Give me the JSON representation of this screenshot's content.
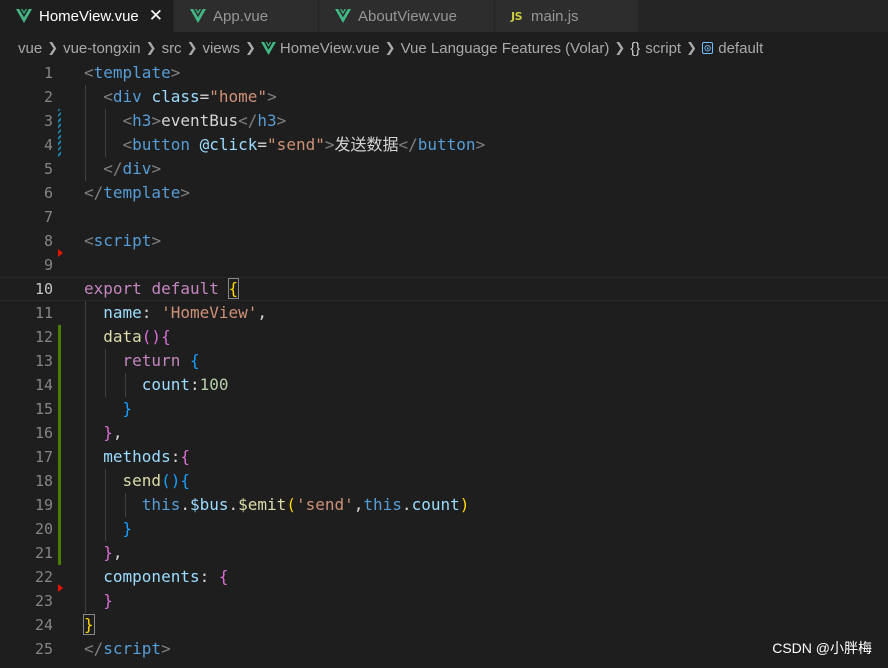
{
  "tabs": [
    {
      "label": "HomeView.vue",
      "icon": "vue-icon",
      "active": true,
      "close": "✕"
    },
    {
      "label": "App.vue",
      "icon": "vue-icon",
      "active": false
    },
    {
      "label": "AboutView.vue",
      "icon": "vue-icon",
      "active": false
    },
    {
      "label": "main.js",
      "icon": "js-icon",
      "icon_text": "JS",
      "active": false
    }
  ],
  "breadcrumb": {
    "parts": [
      "vue",
      "vue-tongxin",
      "src",
      "views",
      "HomeView.vue",
      "Vue Language Features (Volar)",
      "script",
      "default"
    ],
    "braces_glyph": "{}"
  },
  "editor": {
    "current_line": 10,
    "line_numbers": [
      "1",
      "2",
      "3",
      "4",
      "5",
      "6",
      "7",
      "8",
      "9",
      "10",
      "11",
      "12",
      "13",
      "14",
      "15",
      "16",
      "17",
      "18",
      "19",
      "20",
      "21",
      "22",
      "23",
      "24",
      "25"
    ],
    "code": {
      "l1": {
        "open": "<",
        "tag": "template",
        "close": ">"
      },
      "l2": {
        "open": "<",
        "tag": "div",
        "attr": "class",
        "eq": "=",
        "val": "\"home\"",
        "close": ">"
      },
      "l3": {
        "open": "<",
        "tag": "h3",
        "close": ">",
        "text": "eventBus",
        "open2": "</",
        "tag2": "h3",
        "close2": ">"
      },
      "l4": {
        "open": "<",
        "tag": "button",
        "attr": "@click",
        "eq": "=",
        "val": "\"send\"",
        "close": ">",
        "text": "发送数据",
        "open2": "</",
        "tag2": "button",
        "close2": ">"
      },
      "l5": {
        "open": "</",
        "tag": "div",
        "close": ">"
      },
      "l6": {
        "open": "</",
        "tag": "template",
        "close": ">"
      },
      "l8": {
        "open": "<",
        "tag": "script",
        "close": ">"
      },
      "l10": {
        "kw1": "export",
        "kw2": "default",
        "brace": "{"
      },
      "l11": {
        "prop": "name",
        "colon": ": ",
        "str": "'HomeView'",
        "comma": ","
      },
      "l12": {
        "fn": "data",
        "paren": "()",
        "brace": "{"
      },
      "l13": {
        "kw": "return",
        "brace": "{"
      },
      "l14": {
        "prop": "count",
        "colon": ":",
        "num": "100"
      },
      "l15": {
        "brace": "}"
      },
      "l16": {
        "brace": "}",
        "comma": ","
      },
      "l17": {
        "prop": "methods",
        "colon": ":",
        "brace": "{"
      },
      "l18": {
        "fn": "send",
        "paren": "()",
        "brace": "{"
      },
      "l19": {
        "this1": "this",
        "dot1": ".",
        "p1": "$bus",
        "dot2": ".",
        "fn": "$emit",
        "po": "(",
        "str": "'send'",
        "comma": ",",
        "this2": "this",
        "dot3": ".",
        "p2": "count",
        "pc": ")"
      },
      "l20": {
        "brace": "}"
      },
      "l21": {
        "brace": "}",
        "comma": ","
      },
      "l22": {
        "prop": "components",
        "colon": ": ",
        "brace": "{"
      },
      "l23": {
        "brace": "}"
      },
      "l24": {
        "brace": "}"
      },
      "l25": {
        "open": "</",
        "tag": "script",
        "close": ">"
      }
    }
  },
  "watermark": "CSDN @小胖梅",
  "colors": {
    "background": "#1e1e1e",
    "tag": "#569cd6",
    "attribute": "#9cdcfe",
    "string": "#ce9178",
    "keyword": "#c586c0",
    "function": "#dcdcaa",
    "number": "#b5cea8",
    "bracket_level1": "#ffd700",
    "bracket_level2": "#da70d6",
    "bracket_level3": "#179fff",
    "gutter_modified": "#487e02",
    "gutter_deleted": "#e51400"
  }
}
